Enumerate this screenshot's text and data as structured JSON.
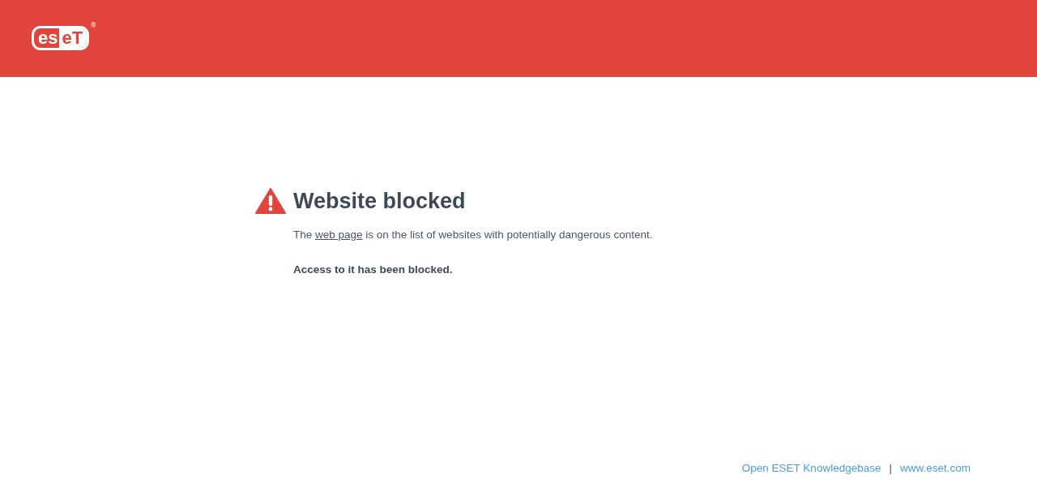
{
  "header": {
    "logo": {
      "left": "es",
      "right": "eT",
      "mark": "®"
    }
  },
  "notice": {
    "title": "Website blocked",
    "message": {
      "before": "The ",
      "link": "web page",
      "after": " is on the list of websites with potentially dangerous content."
    },
    "conclusion": "Access to it has been blocked."
  },
  "footer": {
    "links": [
      {
        "label": "Open ESET Knowledgebase"
      },
      {
        "label": "www.eset.com"
      }
    ],
    "separator": "|"
  }
}
